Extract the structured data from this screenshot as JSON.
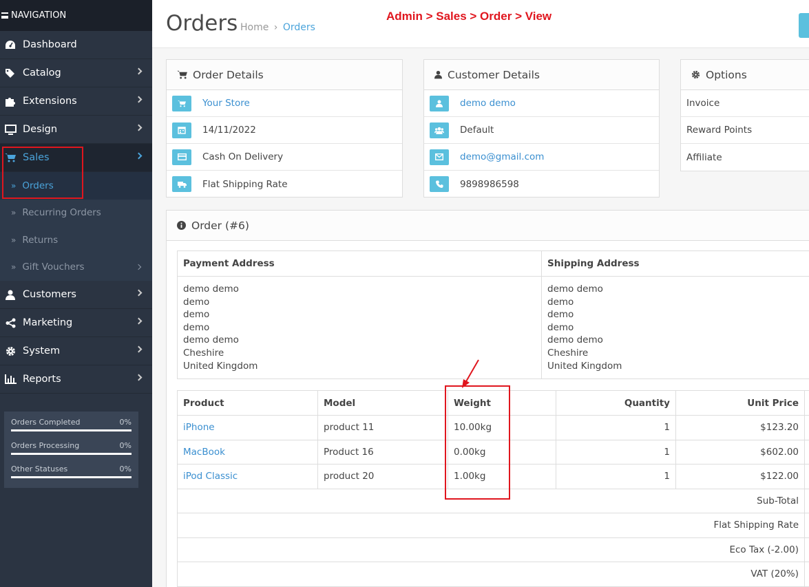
{
  "nav": {
    "header": "NAVIGATION",
    "items": [
      {
        "label": "Dashboard",
        "icon": "dashboard-icon"
      },
      {
        "label": "Catalog",
        "icon": "tags-icon"
      },
      {
        "label": "Extensions",
        "icon": "puzzle-icon"
      },
      {
        "label": "Design",
        "icon": "monitor-icon"
      },
      {
        "label": "Sales",
        "icon": "cart-icon"
      },
      {
        "label": "Customers",
        "icon": "user-icon"
      },
      {
        "label": "Marketing",
        "icon": "share-icon"
      },
      {
        "label": "System",
        "icon": "gear-icon"
      },
      {
        "label": "Reports",
        "icon": "bar-chart-icon"
      }
    ],
    "sales_sub": [
      "Orders",
      "Recurring Orders",
      "Returns",
      "Gift Vouchers"
    ]
  },
  "stats": [
    {
      "label": "Orders Completed",
      "value": "0%"
    },
    {
      "label": "Orders Processing",
      "value": "0%"
    },
    {
      "label": "Other Statuses",
      "value": "0%"
    }
  ],
  "header": {
    "title": "Orders",
    "breadcrumb_home": "Home",
    "breadcrumb_sep": "›",
    "breadcrumb_current": "Orders",
    "caption": "Admin > Sales > Order > View"
  },
  "order_details": {
    "title": "Order Details",
    "store": "Your Store",
    "date": "14/11/2022",
    "payment": "Cash On Delivery",
    "shipping": "Flat Shipping Rate"
  },
  "customer_details": {
    "title": "Customer Details",
    "name": "demo demo",
    "group": "Default",
    "email": "demo@gmail.com",
    "phone": "9898986598"
  },
  "options": {
    "title": "Options",
    "rows": [
      "Invoice",
      "Reward Points",
      "Affiliate"
    ]
  },
  "order": {
    "title": "Order (#6)",
    "payment_address_label": "Payment Address",
    "shipping_address_label": "Shipping Address",
    "payment_address": [
      "demo demo",
      "demo",
      "demo",
      "demo",
      "demo demo",
      "Cheshire",
      "United Kingdom"
    ],
    "shipping_address": [
      "demo demo",
      "demo",
      "demo",
      "demo",
      "demo demo",
      "Cheshire",
      "United Kingdom"
    ],
    "columns": [
      "Product",
      "Model",
      "Weight",
      "Quantity",
      "Unit Price"
    ],
    "products": [
      {
        "product": "iPhone",
        "model": "product 11",
        "weight": "10.00kg",
        "quantity": "1",
        "price": "$123.20"
      },
      {
        "product": "MacBook",
        "model": "Product 16",
        "weight": "0.00kg",
        "quantity": "1",
        "price": "$602.00"
      },
      {
        "product": "iPod Classic",
        "model": "product 20",
        "weight": "1.00kg",
        "quantity": "1",
        "price": "$122.00"
      }
    ],
    "totals": [
      "Sub-Total",
      "Flat Shipping Rate",
      "Eco Tax (-2.00)",
      "VAT (20%)"
    ]
  },
  "colors": {
    "accent": "#4ba4db",
    "info_button": "#5bc0de",
    "annotation_red": "#e0161e",
    "sidebar": "#2b3442"
  }
}
